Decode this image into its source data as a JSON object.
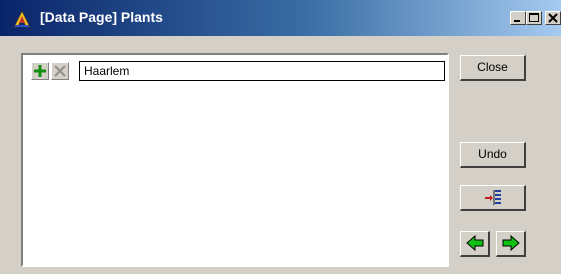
{
  "window": {
    "title": "[Data Page] Plants",
    "icon": "app-icon"
  },
  "caption_buttons": [
    "minimize-icon",
    "maximize-icon",
    "close-icon"
  ],
  "list": {
    "rows": [
      {
        "value": "Haarlem"
      }
    ],
    "add_icon": "plus-icon",
    "delete_icon": "x-icon"
  },
  "buttons": {
    "close_label": "Close",
    "undo_label": "Undo",
    "insert_icon": "insert-tree-icon",
    "prev_icon": "arrow-left-icon",
    "next_icon": "arrow-right-icon"
  },
  "colors": {
    "titlebar_start": "#0a246a",
    "titlebar_end": "#a6caf0",
    "face": "#d4d0c8",
    "arrow_green": "#00a000"
  }
}
